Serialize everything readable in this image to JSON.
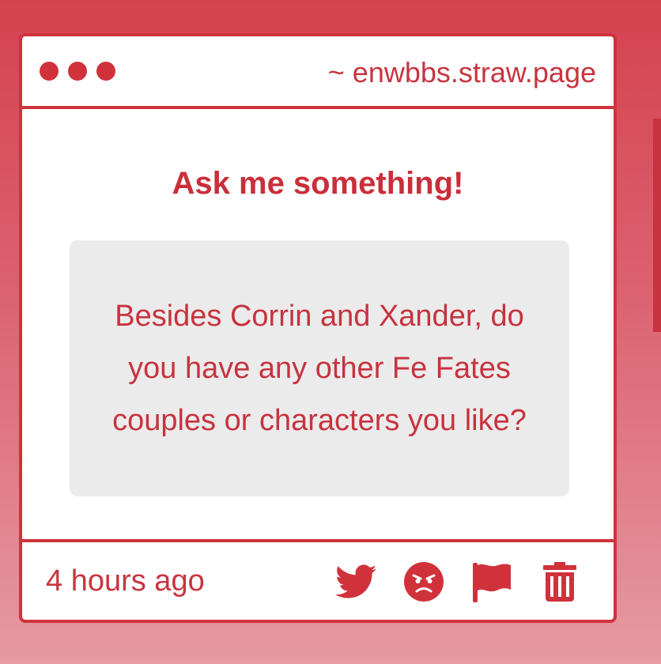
{
  "window": {
    "url_text": "~ enwbbs.straw.page"
  },
  "main": {
    "heading": "Ask me something!",
    "question": "Besides Corrin and Xander, do you have any other Fe Fates couples or characters you like?"
  },
  "footer": {
    "timestamp": "4 hours ago",
    "actions": [
      {
        "icon": "twitter-icon"
      },
      {
        "icon": "angry-face-icon"
      },
      {
        "icon": "flag-icon"
      },
      {
        "icon": "trash-icon"
      }
    ]
  },
  "colors": {
    "accent": "#d0323c",
    "background_top": "#d5414f",
    "background_bottom": "#e69aa2",
    "question_bg": "#ecebec"
  }
}
